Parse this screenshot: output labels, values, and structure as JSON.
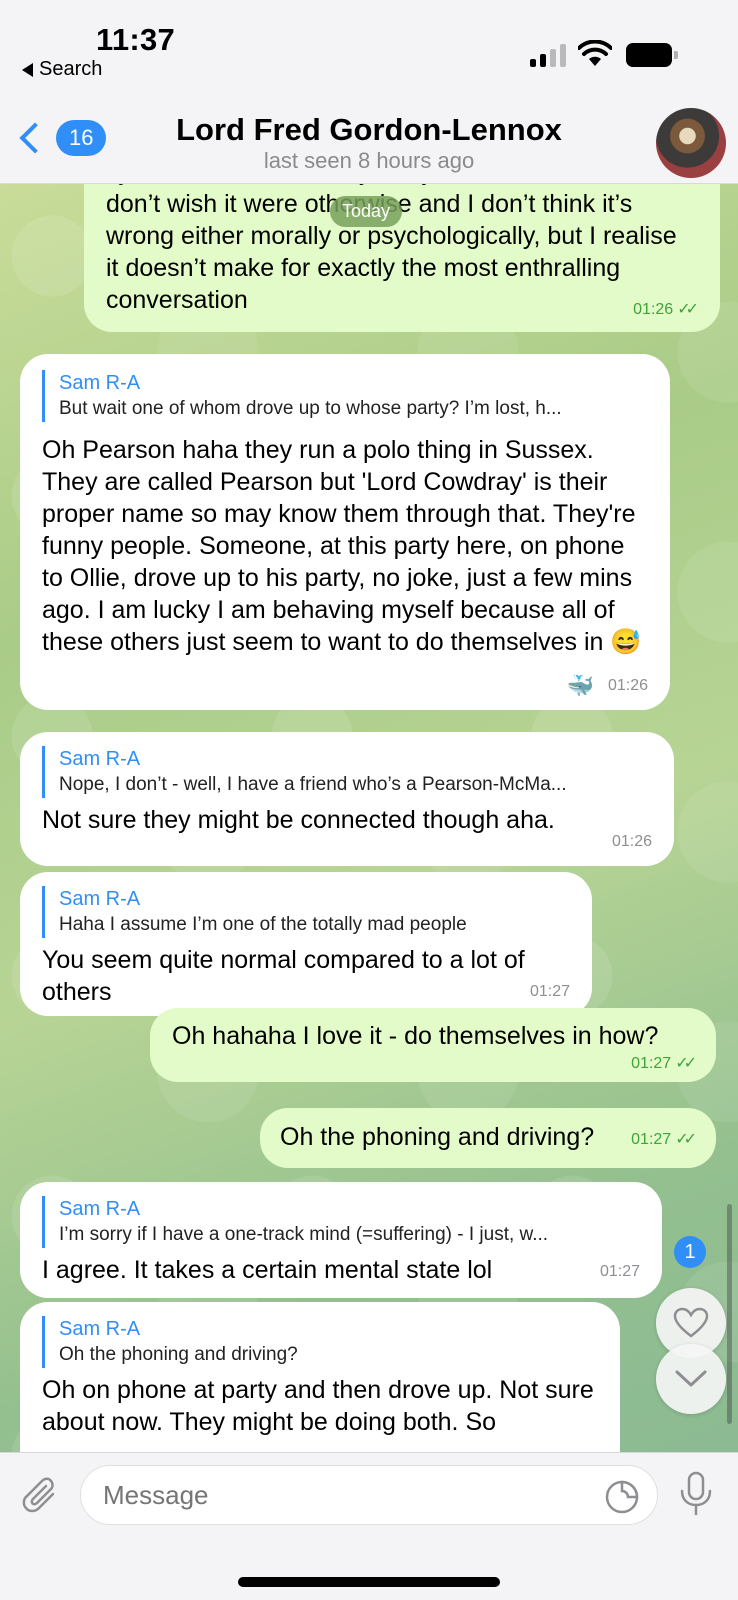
{
  "status": {
    "time": "11:37",
    "back_app": "Search"
  },
  "header": {
    "unread_count": "16",
    "title": "Lord Fred Gordon-Lennox",
    "subtitle": "last seen 8 hours ago"
  },
  "chat": {
    "date_pill": "Today",
    "messages": [
      {
        "text": "I just, well, I’m not really sorry, I don’t feel sorrow, I don’t wish it were otherwise and I don’t think it’s wrong either morally or psychologically, but I realise it doesn’t make for exactly the most enthralling conversation",
        "time": "01:26"
      },
      {
        "reply_name": "Sam R-A",
        "reply_text": "But wait one of whom drove up to whose party? I’m lost, h...",
        "text": "Oh Pearson haha they run a polo thing in Sussex. They are called Pearson but 'Lord Cowdray' is their proper name so may know them through that. They're funny people. Someone, at this party here, on phone to Ollie, drove up to his party, no joke, just a few mins ago. I am lucky I am behaving myself because all of these others just seem to want to do themselves in 😅",
        "reaction": "🐳",
        "time": "01:26"
      },
      {
        "reply_name": "Sam R-A",
        "reply_text": "Nope, I don’t - well, I have a friend who’s a Pearson-McMa...",
        "text": "Not sure they might be connected though aha.",
        "time": "01:26"
      },
      {
        "reply_name": "Sam R-A",
        "reply_text": "Haha I assume I’m one of the totally mad people",
        "text": "You seem quite normal compared to a lot of others",
        "time": "01:27"
      },
      {
        "text": "Oh hahaha I love it - do themselves in how?",
        "time": "01:27"
      },
      {
        "text": "Oh the phoning and driving?",
        "time": "01:27"
      },
      {
        "reply_name": "Sam R-A",
        "reply_text": "I’m sorry if I have a one-track mind (=suffering) - I just, w...",
        "text": "I agree. It takes a certain mental state lol",
        "time": "01:27"
      },
      {
        "reply_name": "Sam R-A",
        "reply_text": "Oh the phoning and driving?",
        "text": "Oh on phone at party and then drove up. Not sure about now. They might be doing both. So"
      }
    ],
    "reactions_badge": "1"
  },
  "composer": {
    "placeholder": "Message"
  },
  "colors": {
    "accent": "#2f8ff6",
    "outgoing_bubble": "#e3fbc9",
    "incoming_bubble": "#ffffff",
    "read_check": "#3fa33a"
  },
  "icons": [
    "back-triangle-icon",
    "signal-icon",
    "wifi-icon",
    "battery-icon",
    "chevron-left-icon",
    "paperclip-icon",
    "sticker-icon",
    "microphone-icon",
    "heart-icon",
    "chevron-down-icon"
  ]
}
